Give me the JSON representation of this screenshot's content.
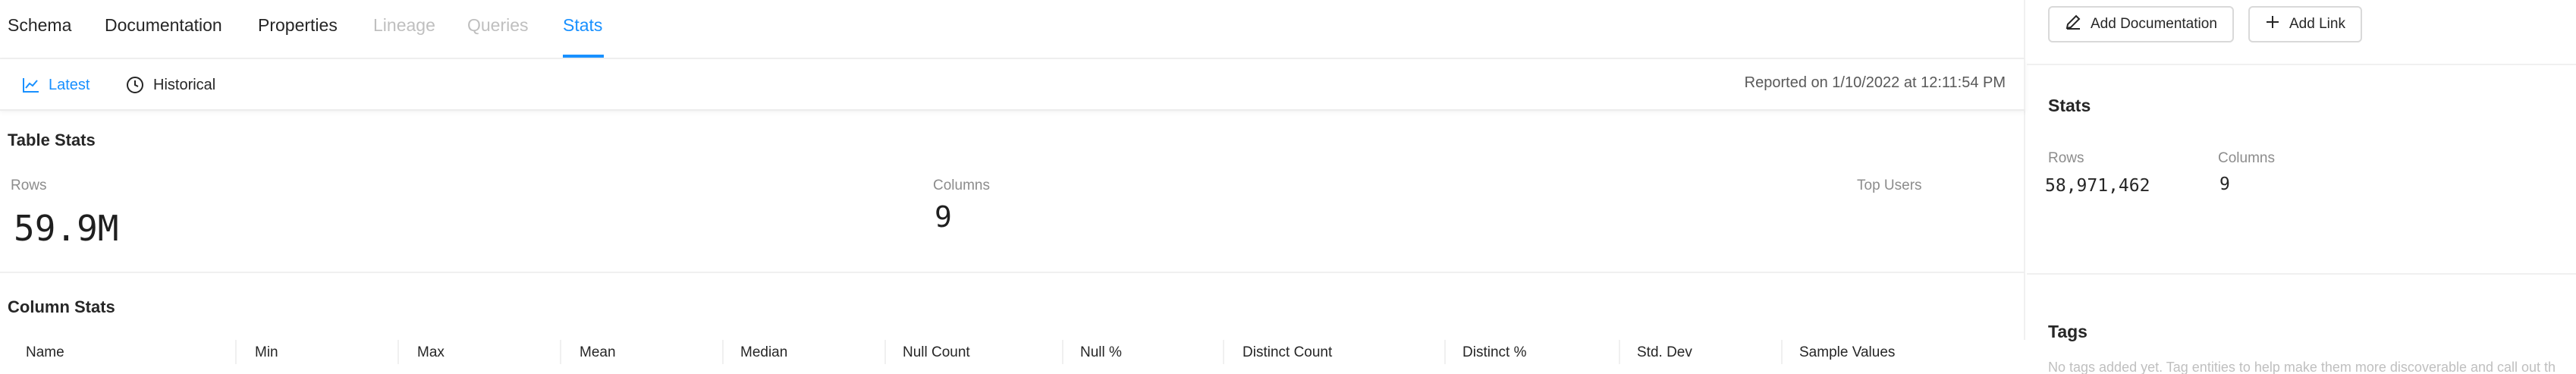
{
  "tabs": [
    {
      "label": "Schema",
      "state": "normal"
    },
    {
      "label": "Documentation",
      "state": "normal"
    },
    {
      "label": "Properties",
      "state": "normal"
    },
    {
      "label": "Lineage",
      "state": "disabled"
    },
    {
      "label": "Queries",
      "state": "disabled"
    },
    {
      "label": "Stats",
      "state": "active"
    }
  ],
  "subbar": {
    "latest_label": "Latest",
    "latest_icon": "line-chart-icon",
    "historical_label": "Historical",
    "historical_icon": "clock-icon",
    "reported": "Reported on 1/10/2022 at 12:11:54 PM"
  },
  "table_stats": {
    "title": "Table Stats",
    "rows_label": "Rows",
    "rows_value": "59.9M",
    "columns_label": "Columns",
    "columns_value": "9",
    "top_users_label": "Top Users"
  },
  "column_stats": {
    "title": "Column Stats",
    "headers": [
      "Name",
      "Min",
      "Max",
      "Mean",
      "Median",
      "Null Count",
      "Null %",
      "Distinct Count",
      "Distinct %",
      "Std. Dev",
      "Sample Values"
    ]
  },
  "sidebar": {
    "add_documentation_label": "Add Documentation",
    "add_documentation_icon": "edit-icon",
    "add_link_label": "Add Link",
    "add_link_icon": "plus-icon",
    "stats_title": "Stats",
    "rows_label": "Rows",
    "rows_value": "58,971,462",
    "columns_label": "Columns",
    "columns_value": "9",
    "tags_title": "Tags",
    "tags_note": "No tags added yet. Tag entities to help make them more discoverable and call out th"
  },
  "colors": {
    "accent": "#1890ff",
    "text": "#262626",
    "muted": "#8c8c8c",
    "disabled": "#bfbfbf",
    "border": "#f0f0f0"
  }
}
